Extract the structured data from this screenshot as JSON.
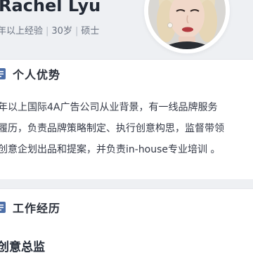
{
  "profile": {
    "name": "Rachel Lyu",
    "experience": "年以上经验",
    "age": "30岁",
    "degree": "硕士"
  },
  "sections": {
    "strengths": {
      "title": "个人优势",
      "icon": "document-icon",
      "lines": [
        "年以上国际4A广告公司从业背景，有一线品牌服务",
        "履历，负责品牌策略制定、执行创意构思，监督带领",
        "创意企划出品和提案，并负责in-house专业培训 。"
      ]
    },
    "work": {
      "title": "工作经历",
      "icon": "document-icon",
      "job_title": "创意总监"
    }
  },
  "colors": {
    "background": "#eef0f3",
    "card": "#ffffff",
    "icon": "#4d6fa8",
    "text": "#232a36"
  }
}
